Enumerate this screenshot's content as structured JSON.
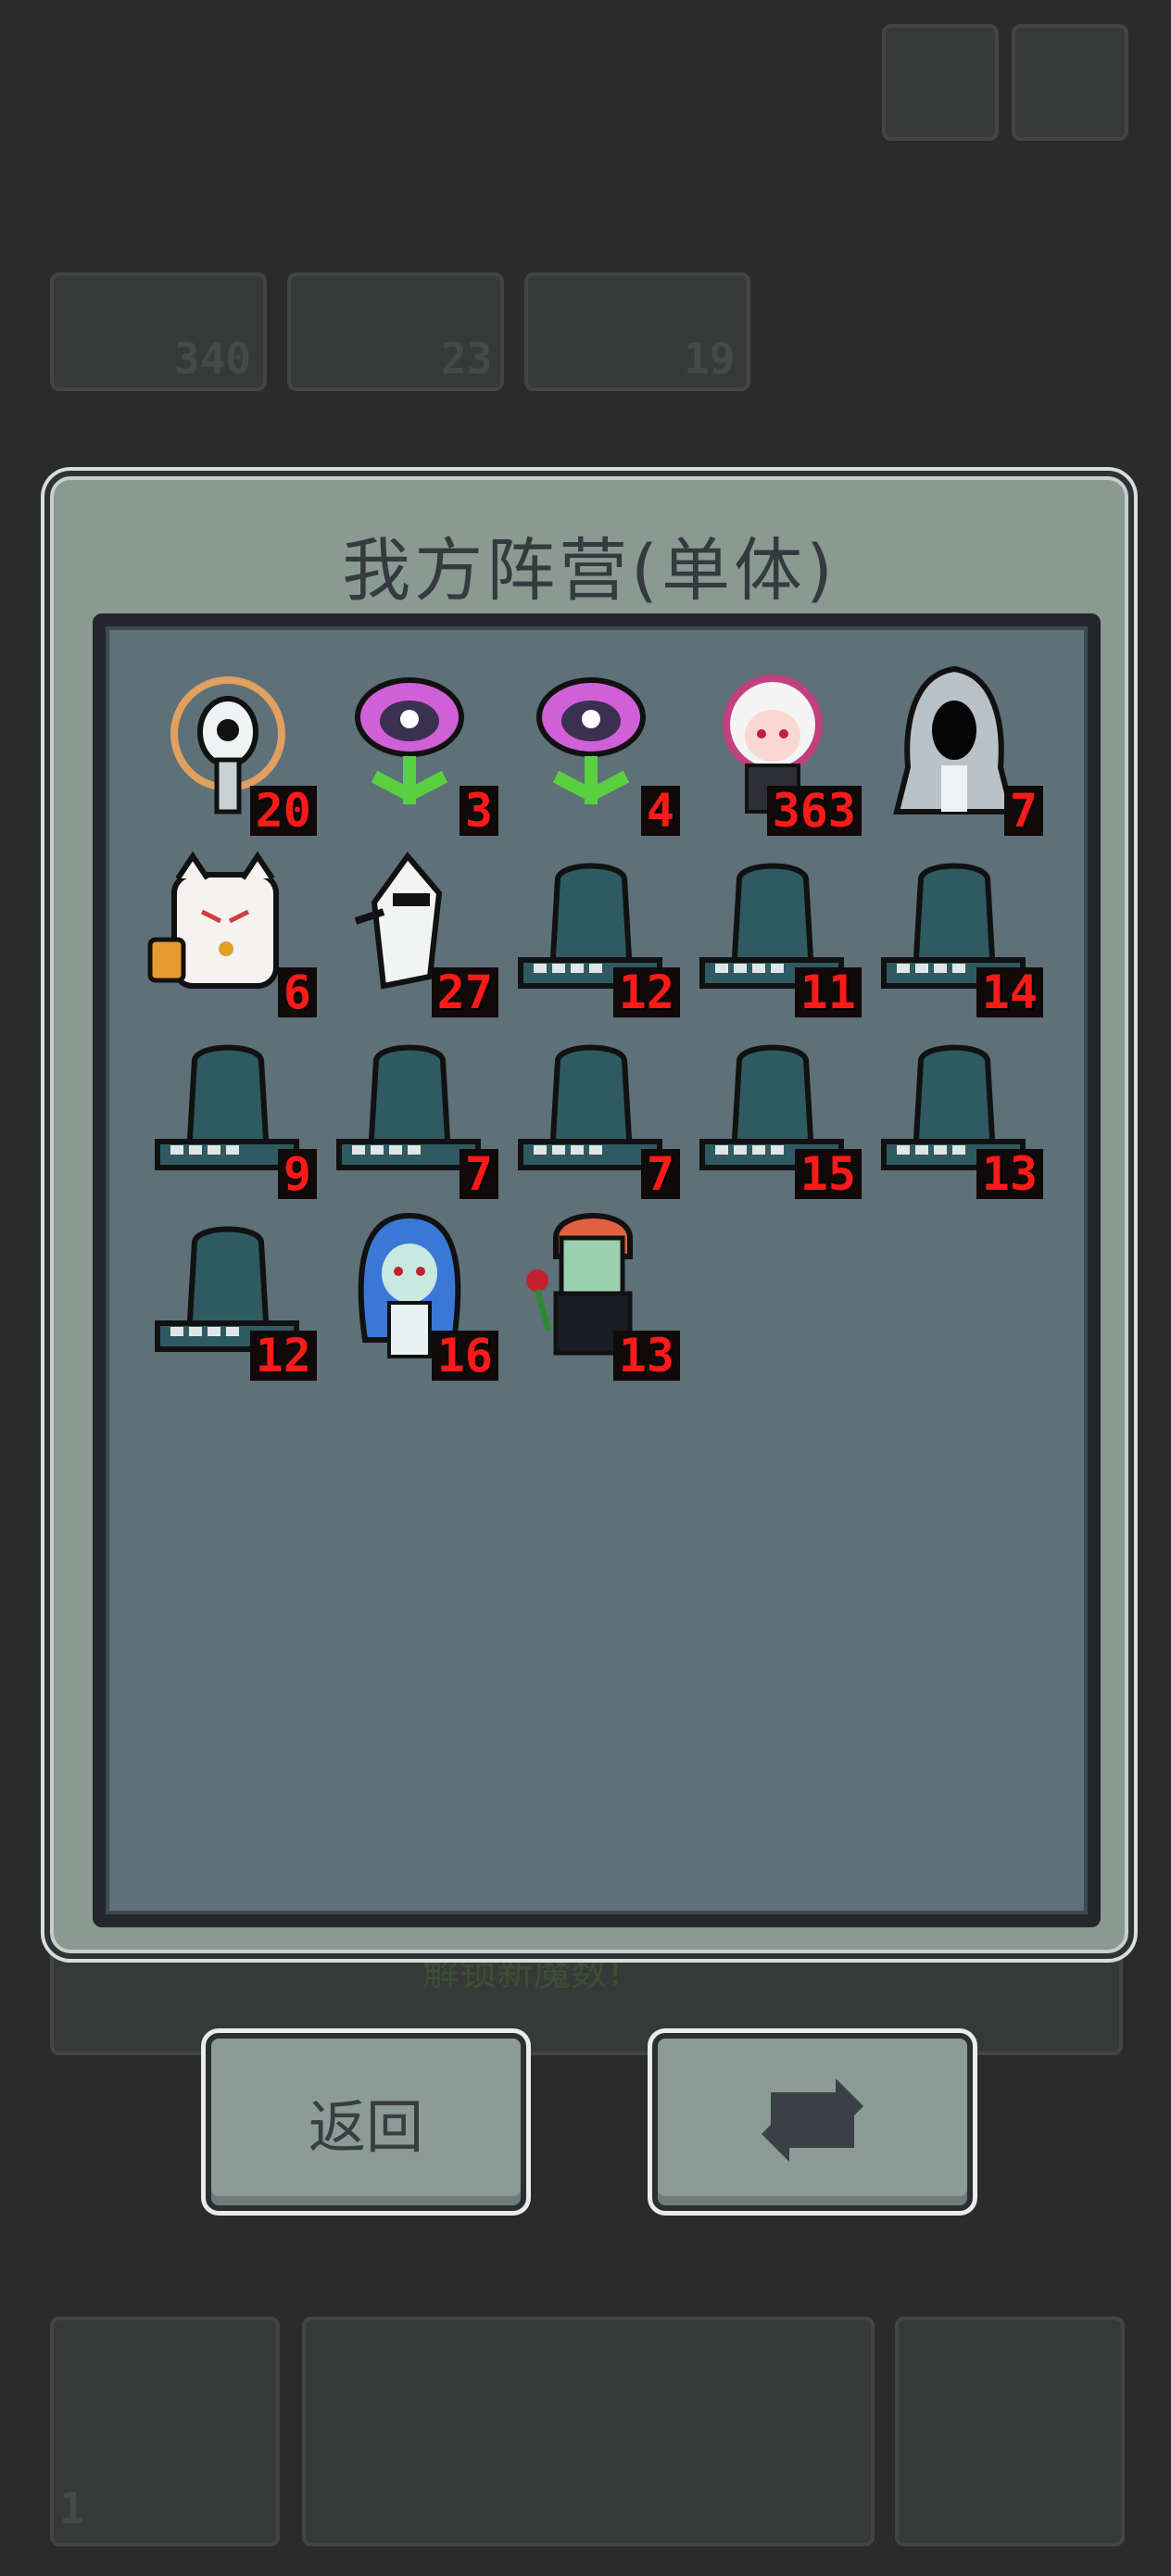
{
  "background": {
    "stats": [
      "340",
      "23",
      "19"
    ],
    "banner_text": "解锁新魔数!",
    "bottom_level": "1"
  },
  "dialog": {
    "title": "我方阵营(单体)",
    "units": [
      {
        "icon": "eye-statue-icon",
        "count": "20"
      },
      {
        "icon": "pink-flower-monster-icon",
        "count": "3"
      },
      {
        "icon": "pink-flower-monster-icon",
        "count": "4"
      },
      {
        "icon": "white-haired-girl-icon",
        "count": "363"
      },
      {
        "icon": "hooded-reaper-icon",
        "count": "7"
      },
      {
        "icon": "lucky-cat-icon",
        "count": "6"
      },
      {
        "icon": "white-ninja-icon",
        "count": "27"
      },
      {
        "icon": "dark-tombstone-icon",
        "count": "12"
      },
      {
        "icon": "dark-tombstone-icon",
        "count": "11"
      },
      {
        "icon": "dark-tombstone-icon",
        "count": "14"
      },
      {
        "icon": "dark-tombstone-icon",
        "count": "9"
      },
      {
        "icon": "dark-tombstone-icon",
        "count": "7"
      },
      {
        "icon": "dark-tombstone-icon",
        "count": "7"
      },
      {
        "icon": "dark-tombstone-icon",
        "count": "15"
      },
      {
        "icon": "dark-tombstone-icon",
        "count": "13"
      },
      {
        "icon": "dark-tombstone-icon",
        "count": "12"
      },
      {
        "icon": "blue-haired-ghost-girl-icon",
        "count": "16"
      },
      {
        "icon": "zombie-gentleman-with-rose-icon",
        "count": "13"
      }
    ]
  },
  "buttons": {
    "back_label": "返回",
    "refresh_icon": "refresh-icon"
  },
  "colors": {
    "count_text": "#ff1a1a",
    "dialog_bg": "#8a9a92",
    "inner_bg": "#5e7078"
  }
}
